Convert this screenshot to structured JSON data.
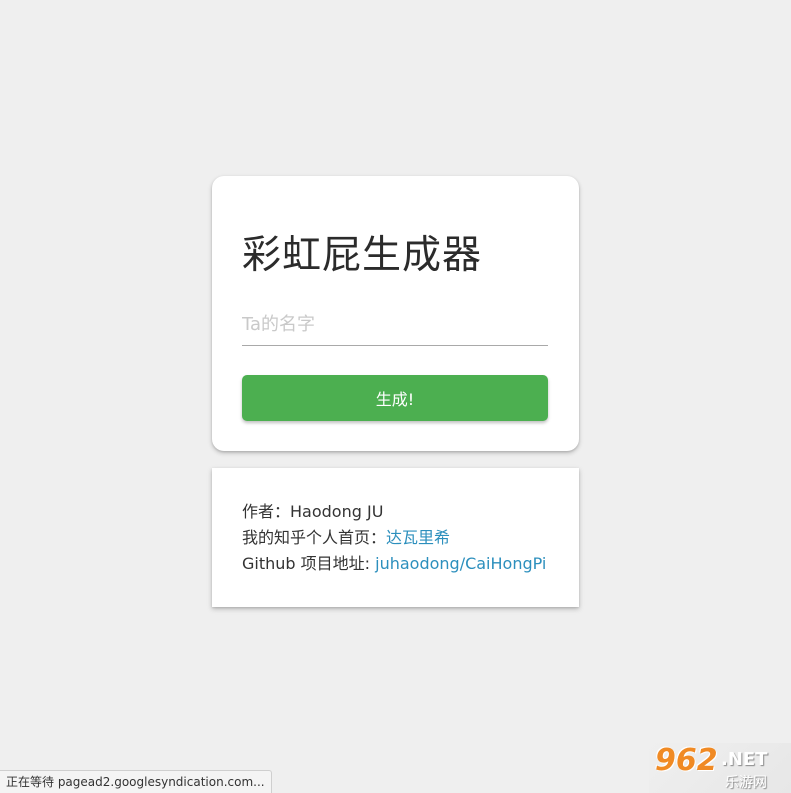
{
  "main_card": {
    "title": "彩虹屁生成器",
    "input_placeholder": "Ta的名字",
    "button_label": "生成!"
  },
  "info_card": {
    "author_label": "作者：",
    "author_name": "Haodong JU",
    "zhihu_label": "我的知乎个人首页：",
    "zhihu_link": "达瓦里希",
    "github_label": "Github 项目地址: ",
    "github_link": "juhaodong/CaiHongPi"
  },
  "status_bar": {
    "text": "正在等待 pagead2.googlesyndication.com..."
  },
  "watermark": {
    "number": "962",
    "net": ".NET",
    "cn": "乐游网"
  },
  "colors": {
    "background": "#efefef",
    "button": "#4caf50",
    "link": "#2c8fbd"
  }
}
